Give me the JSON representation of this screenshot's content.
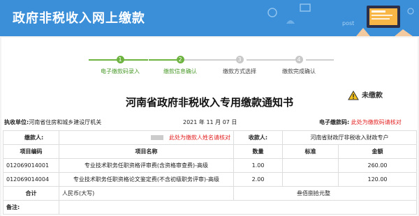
{
  "header": {
    "title": "政府非税收入网上缴款"
  },
  "steps": [
    {
      "num": "1",
      "label": "电子缴款码录入",
      "state": "done"
    },
    {
      "num": "2",
      "label": "缴款信息确认",
      "state": "done"
    },
    {
      "num": "3",
      "label": "缴款方式选择",
      "state": "todo"
    },
    {
      "num": "4",
      "label": "缴款完成确认",
      "state": "todo"
    }
  ],
  "document": {
    "title": "河南省政府非税收入专用缴款通知书",
    "status": "未缴款",
    "executor_label": "执收单位:",
    "executor_value": "河南省住房和城乡建设厅机关",
    "date": "2021 年  11 月 07 日",
    "code_label": "电子缴款码:",
    "code_note": "此处为缴款码请核对"
  },
  "table": {
    "payer_label": "缴款人:",
    "payer_note": "此处为缴款人姓名请核对",
    "payee_label": "收款人:",
    "payee_value": "河南省财政厅非税收入财政专户",
    "headers": {
      "code": "项目编码",
      "name": "项目名称",
      "qty": "数量",
      "standard": "标准",
      "amount": "金额"
    },
    "items": [
      {
        "code": "012069014001",
        "name": "专业技术职务任职资格评审费(含资格审查费)-高级",
        "qty": "1.00",
        "standard": "",
        "amount": "260.00"
      },
      {
        "code": "012069014004",
        "name": "专业技术职务任职资格论文鉴定费(不含初级职务评审)-高级",
        "qty": "2.00",
        "standard": "",
        "amount": "120.00"
      }
    ],
    "total_label": "合计",
    "total_currency": "人民币(大写)",
    "total_words": "叁佰捌拾元整",
    "remarks_label": "备注:"
  },
  "colors": {
    "banner": "#3b8fd9",
    "step_done": "#6db33f",
    "step_todo": "#c8c8c8",
    "note_red": "#e32020"
  }
}
